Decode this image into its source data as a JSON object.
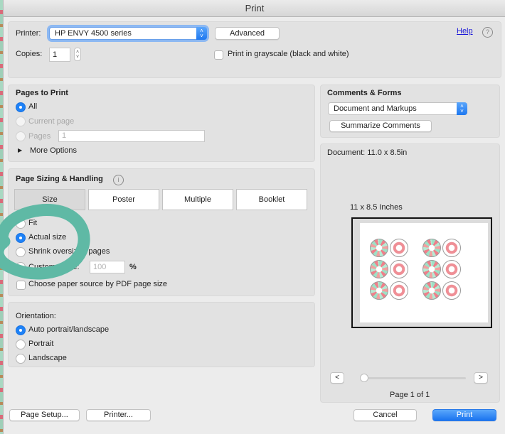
{
  "window": {
    "title": "Print"
  },
  "printer_section": {
    "printer_label": "Printer:",
    "printer_value": "HP ENVY 4500 series",
    "advanced_label": "Advanced",
    "help_link": "Help",
    "help_icon": "question-circle-icon",
    "copies_label": "Copies:",
    "copies_value": "1",
    "grayscale_label": "Print in grayscale (black and white)",
    "grayscale_checked": false
  },
  "pages_to_print": {
    "title": "Pages to Print",
    "options": [
      {
        "label": "All",
        "selected": true,
        "enabled": true
      },
      {
        "label": "Current page",
        "selected": false,
        "enabled": false
      },
      {
        "label": "Pages",
        "selected": false,
        "enabled": false
      }
    ],
    "pages_value": "1",
    "more_options_label": "More Options"
  },
  "page_sizing": {
    "title": "Page Sizing & Handling",
    "info_icon": "info-circle-icon",
    "tabs": [
      {
        "label": "Size",
        "active": true
      },
      {
        "label": "Poster",
        "active": false
      },
      {
        "label": "Multiple",
        "active": false
      },
      {
        "label": "Booklet",
        "active": false
      }
    ],
    "options": [
      {
        "label": "Fit",
        "selected": false
      },
      {
        "label": "Actual size",
        "selected": true
      },
      {
        "label": "Shrink oversized pages",
        "selected": false
      },
      {
        "label": "Custom Scale:",
        "selected": false
      }
    ],
    "custom_scale_value": "100",
    "custom_scale_unit": "%",
    "paper_source_label": "Choose paper source by PDF page size",
    "paper_source_checked": false
  },
  "orientation": {
    "title": "Orientation:",
    "options": [
      {
        "label": "Auto portrait/landscape",
        "selected": true
      },
      {
        "label": "Portrait",
        "selected": false
      },
      {
        "label": "Landscape",
        "selected": false
      }
    ]
  },
  "comments_forms": {
    "title": "Comments & Forms",
    "selected": "Document and Markups",
    "summarize_label": "Summarize Comments"
  },
  "preview": {
    "document_size": "Document: 11.0 x 8.5in",
    "paper_label": "11 x 8.5 Inches",
    "prev_label": "<",
    "next_label": ">",
    "page_indicator": "Page 1 of 1",
    "slider_position": 0,
    "current_page": 1,
    "total_pages": 1
  },
  "footer": {
    "page_setup_label": "Page Setup...",
    "printer_label": "Printer...",
    "cancel_label": "Cancel",
    "print_label": "Print"
  },
  "colors": {
    "accent": "#1e82f7",
    "annotation": "#5fb9a5",
    "link": "#1b18d8"
  }
}
